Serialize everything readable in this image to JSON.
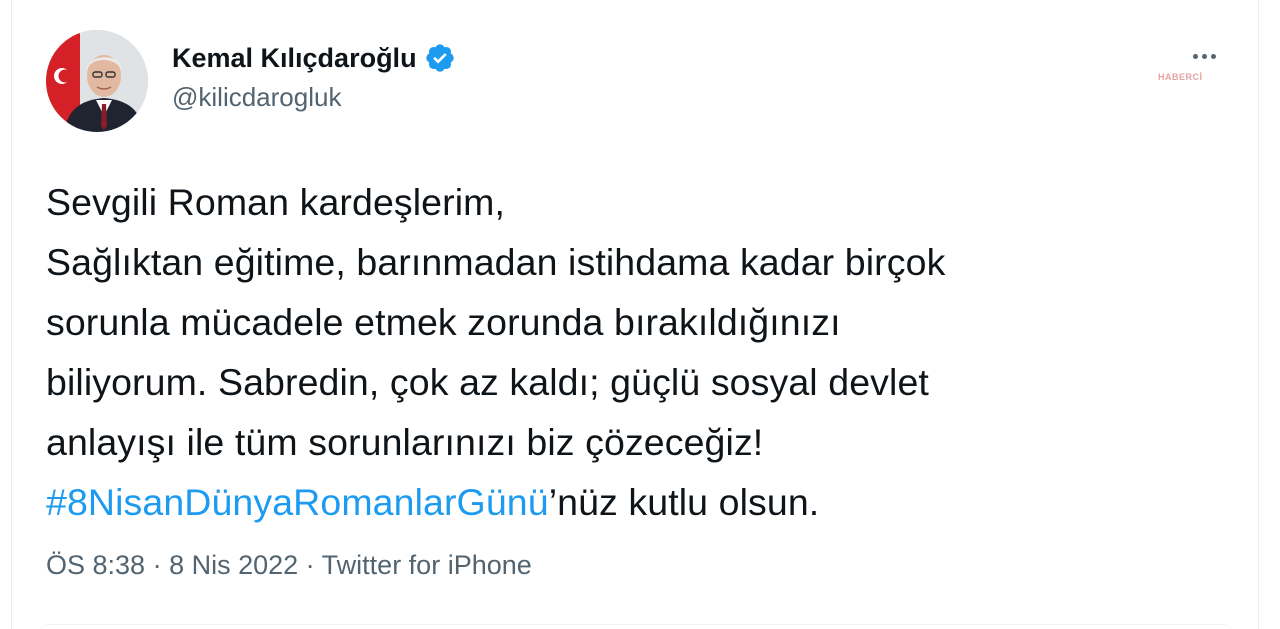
{
  "author": {
    "display_name": "Kemal Kılıçdaroğlu",
    "handle": "@kilicdarogluk",
    "verified": true
  },
  "watermark": "HABERCİ",
  "tweet": {
    "lines": [
      "Sevgili Roman kardeşlerim,",
      "Sağlıktan eğitime, barınmadan istihdama kadar birçok",
      "sorunla mücadele etmek zorunda bırakıldığınızı",
      "biliyorum. Sabredin, çok az kaldı; güçlü sosyal devlet",
      "anlayışı ile tüm sorunlarınızı biz çözeceğiz!"
    ],
    "hashtag": "#8NisanDünyaRomanlarGünü",
    "hashtag_suffix": "’nüz kutlu olsun."
  },
  "meta": {
    "time": "ÖS 8:38",
    "separator": " · ",
    "date": "8 Nis 2022",
    "source": "Twitter for iPhone"
  },
  "colors": {
    "text": "#0f1419",
    "secondary": "#536471",
    "accent": "#1d9bf0"
  },
  "icons": {
    "verified": "verified-badge-icon",
    "more": "more-options-icon"
  }
}
